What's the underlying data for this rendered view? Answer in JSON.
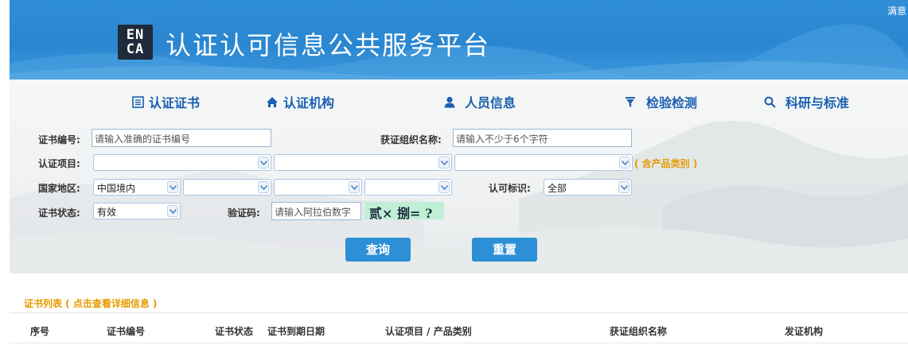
{
  "header": {
    "logo_text_line1": "EN",
    "logo_text_line2": "CA",
    "title": "认证认可信息公共服务平台",
    "top_right": "满意"
  },
  "nav": {
    "items": [
      {
        "label": "认证证书",
        "icon": "certificate-icon"
      },
      {
        "label": "认证机构",
        "icon": "home-icon"
      },
      {
        "label": "人员信息",
        "icon": "user-icon"
      },
      {
        "label": "检验检测",
        "icon": "filter-icon"
      },
      {
        "label": "科研与标准",
        "icon": "search-icon"
      }
    ]
  },
  "form": {
    "cert_no_label": "证书编号:",
    "cert_no_placeholder": "请输入准确的证书编号",
    "org_name_label": "获证组织名称:",
    "org_name_placeholder": "请输入不少于6个字符",
    "project_label": "认证项目:",
    "project_note": "( 含产品类别 )",
    "region_label": "国家地区:",
    "region_value": "中国境内",
    "mark_label": "认可标识:",
    "mark_value": "全部",
    "status_label": "证书状态:",
    "status_value": "有效",
    "captcha_label": "验证码:",
    "captcha_placeholder": "请输入阿拉伯数字",
    "captcha_text": "贰× 捌= ?",
    "query_button": "查询",
    "reset_button": "重置"
  },
  "results": {
    "caption": "证书列表 ( 点击查看详细信息 )",
    "columns": [
      "序号",
      "证书编号",
      "证书状态",
      "证书到期日期",
      "认证项目 / 产品类别",
      "获证组织名称",
      "发证机构"
    ]
  },
  "colors": {
    "banner_blue": "#2f8fd6",
    "nav_text": "#1a5fb0",
    "accent_orange": "#e69a00",
    "button_blue": "#2d8fd5",
    "captcha_bg": "#bff0d6"
  }
}
